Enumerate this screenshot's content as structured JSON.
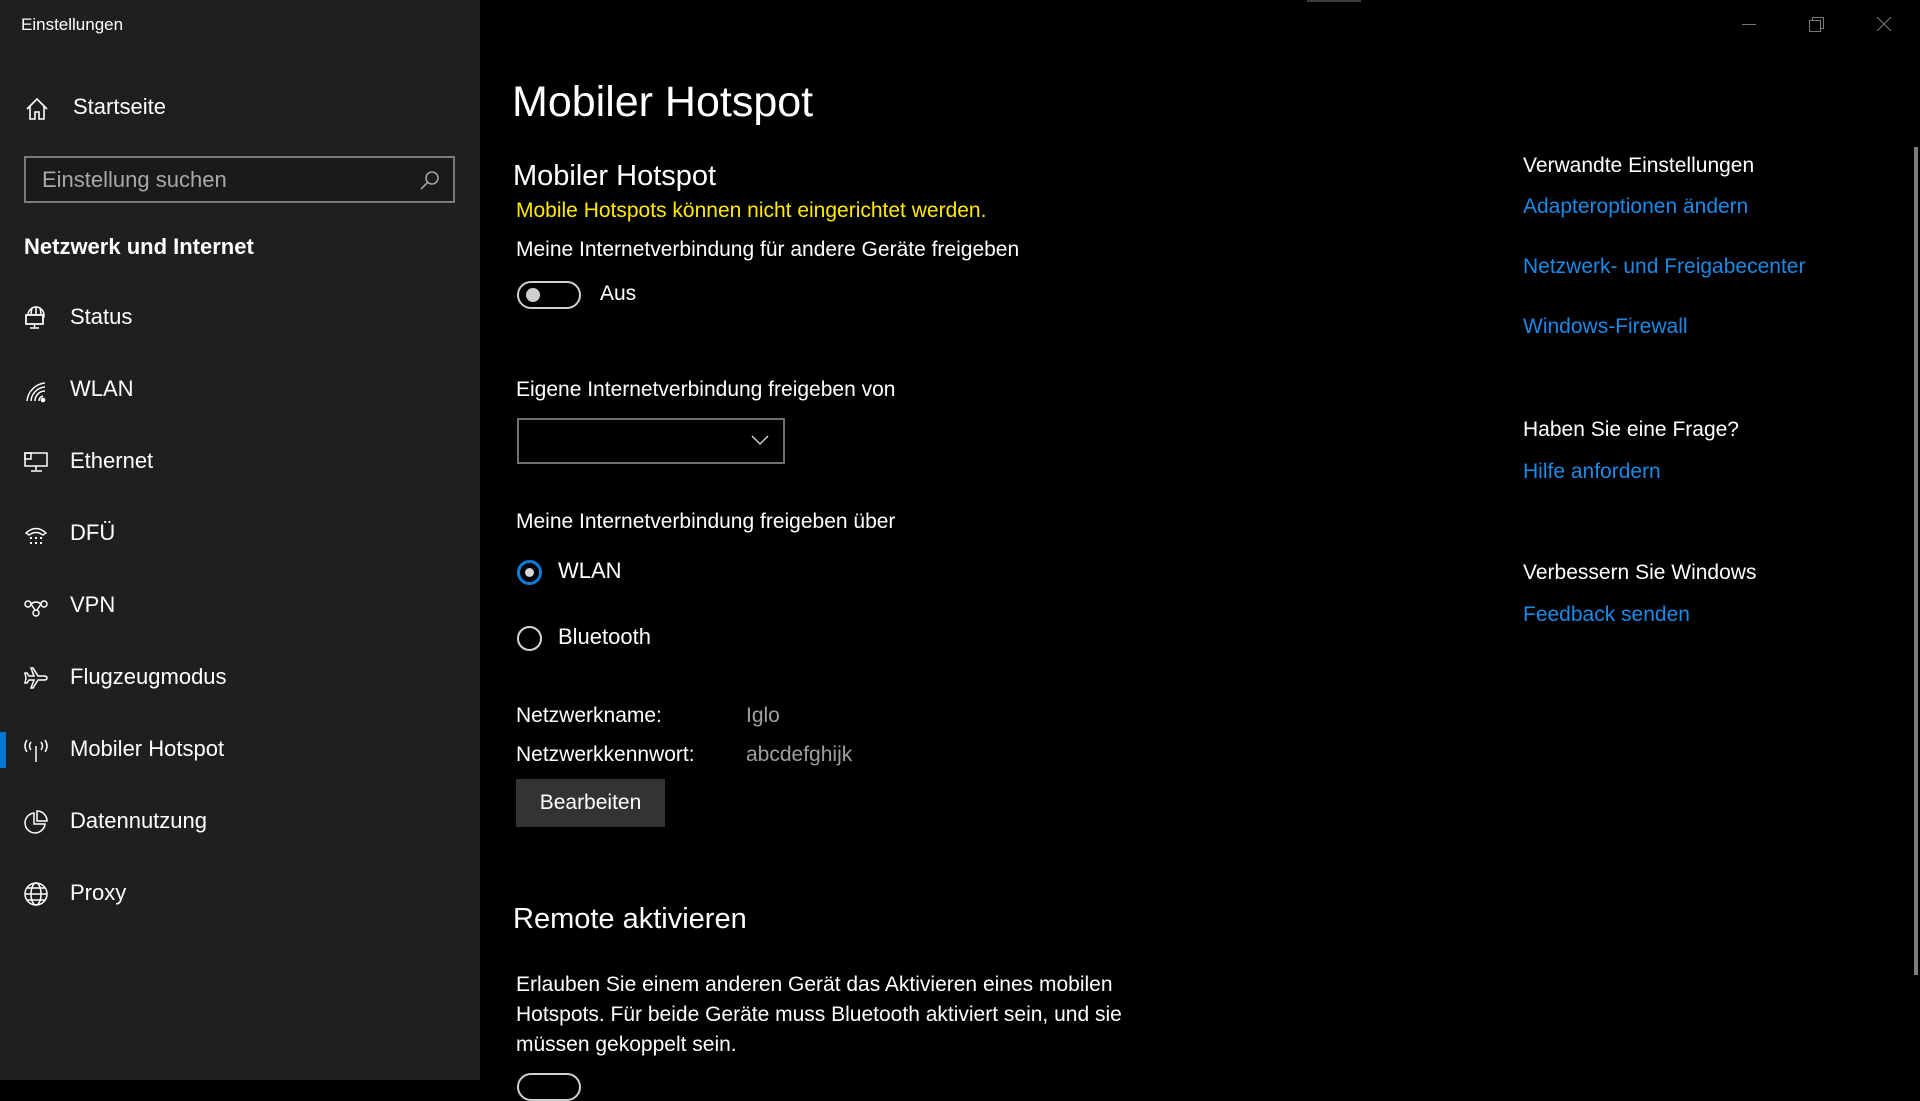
{
  "window": {
    "title": "Einstellungen",
    "controls": {
      "minimize": "minimize-icon",
      "restore": "restore-icon",
      "close": "close-icon"
    }
  },
  "sidebar": {
    "home": {
      "label": "Startseite",
      "icon": "home-icon"
    },
    "search": {
      "placeholder": "Einstellung suchen",
      "value": "",
      "icon": "search-icon"
    },
    "section_title": "Netzwerk und Internet",
    "items": [
      {
        "label": "Status",
        "icon": "network-status-icon",
        "selected": false
      },
      {
        "label": "WLAN",
        "icon": "wifi-icon",
        "selected": false
      },
      {
        "label": "Ethernet",
        "icon": "ethernet-icon",
        "selected": false
      },
      {
        "label": "DFÜ",
        "icon": "dial-up-icon",
        "selected": false
      },
      {
        "label": "VPN",
        "icon": "vpn-icon",
        "selected": false
      },
      {
        "label": "Flugzeugmodus",
        "icon": "airplane-icon",
        "selected": false
      },
      {
        "label": "Mobiler Hotspot",
        "icon": "hotspot-icon",
        "selected": true
      },
      {
        "label": "Datennutzung",
        "icon": "data-usage-icon",
        "selected": false
      },
      {
        "label": "Proxy",
        "icon": "globe-icon",
        "selected": false
      }
    ],
    "accent_color": "#0078d7"
  },
  "main": {
    "page_title": "Mobiler Hotspot",
    "section_title": "Mobiler Hotspot",
    "warning": "Mobile Hotspots können nicht eingerichtet werden.",
    "warning_color": "#ffea00",
    "share_label": "Meine Internetverbindung für andere Geräte freigeben",
    "share_toggle": {
      "state": "off",
      "label": "Aus"
    },
    "share_from_label": "Eigene Internetverbindung freigeben von",
    "share_from_value": "",
    "share_via_label": "Meine Internetverbindung freigeben über",
    "share_via_options": [
      {
        "label": "WLAN",
        "selected": true
      },
      {
        "label": "Bluetooth",
        "selected": false
      }
    ],
    "network_name_label": "Netzwerkname:",
    "network_name_value": "Iglo",
    "network_password_label": "Netzwerkkennwort:",
    "network_password_value": "abcdefghijk",
    "edit_button": "Bearbeiten",
    "remote_title": "Remote aktivieren",
    "remote_description": "Erlauben Sie einem anderen Gerät das Aktivieren eines mobilen Hotspots. Für beide Geräte muss Bluetooth aktiviert sein, und sie müssen gekoppelt sein."
  },
  "related": {
    "heading": "Verwandte Einstellungen",
    "links": [
      "Adapteroptionen ändern",
      "Netzwerk- und Freigabecenter",
      "Windows-Firewall"
    ],
    "question_heading": "Haben Sie eine Frage?",
    "help_link": "Hilfe anfordern",
    "improve_heading": "Verbessern Sie Windows",
    "feedback_link": "Feedback senden",
    "link_color": "#1a8ae6"
  }
}
